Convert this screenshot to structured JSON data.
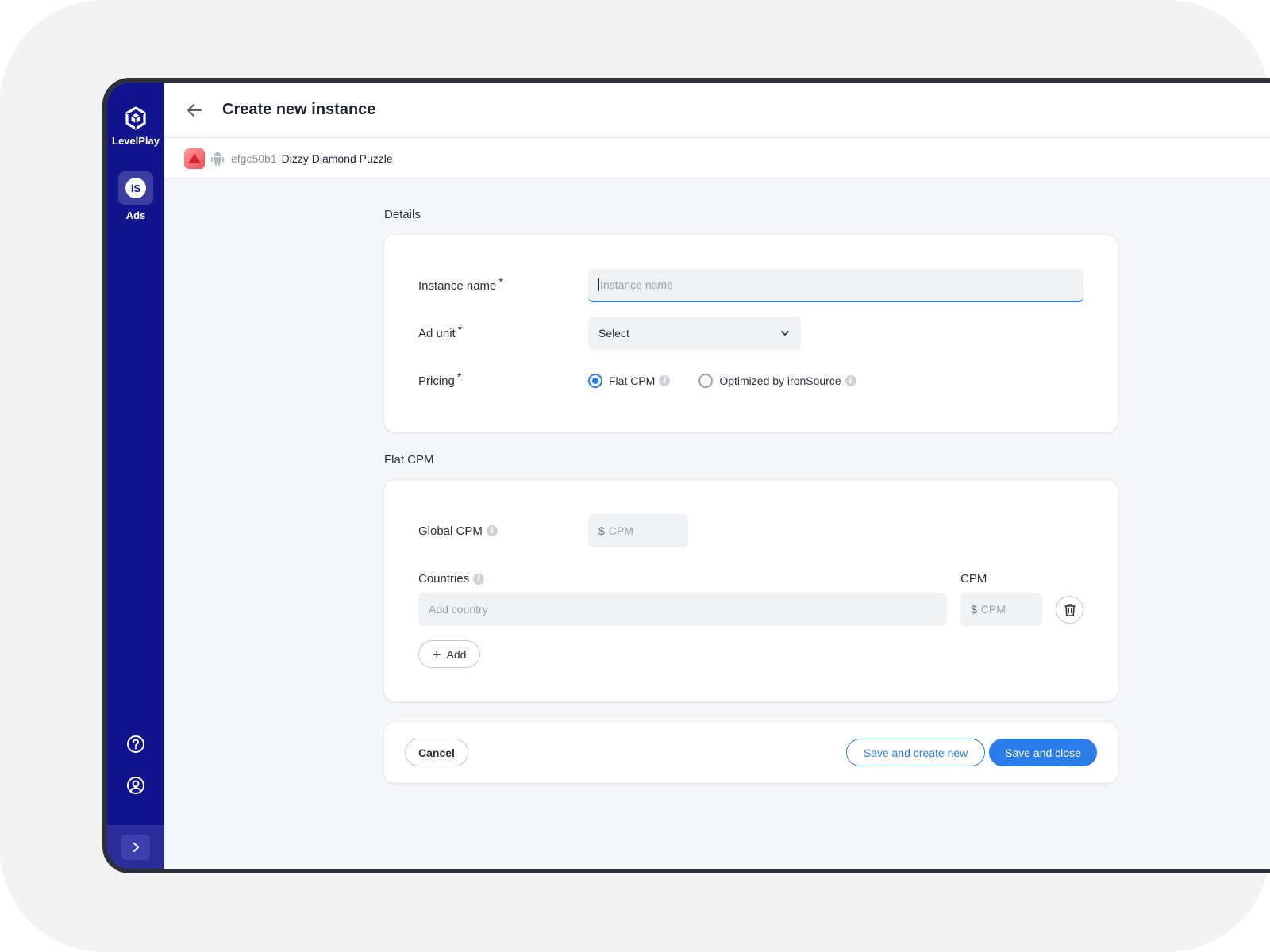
{
  "sidebar": {
    "brand_label": "LevelPlay",
    "ads_badge": "iS",
    "ads_label": "Ads"
  },
  "header": {
    "title": "Create new instance"
  },
  "app": {
    "id": "efgc50b1",
    "name": "Dizzy Diamond Puzzle"
  },
  "details": {
    "section_title": "Details",
    "instance_name_label": "Instance name",
    "instance_name_placeholder": "Instance name",
    "ad_unit_label": "Ad unit",
    "ad_unit_value": "Select",
    "pricing_label": "Pricing",
    "pricing_options": [
      {
        "label": "Flat CPM",
        "checked": true
      },
      {
        "label": "Optimized by ironSource",
        "checked": false
      }
    ],
    "required_mark": "*"
  },
  "flat_cpm": {
    "section_title": "Flat CPM",
    "global_cpm_label": "Global CPM",
    "currency": "$",
    "cpm_placeholder": "CPM",
    "countries_label": "Countries",
    "cpm_column_label": "CPM",
    "country_placeholder": "Add country",
    "add_label": "Add"
  },
  "footer": {
    "cancel_label": "Cancel",
    "save_new_label": "Save and create new",
    "save_close_label": "Save and close"
  },
  "colors": {
    "sidebar": "#11148c",
    "accent": "#2b7de9"
  },
  "icons": {
    "brand": "unity-cube-icon",
    "back": "arrow-left-icon",
    "platform": "android-icon",
    "dropdown": "chevron-down-icon",
    "info": "info-icon",
    "delete": "trash-icon",
    "help": "help-circle-icon",
    "user": "user-circle-icon",
    "expand": "chevron-right-icon"
  }
}
